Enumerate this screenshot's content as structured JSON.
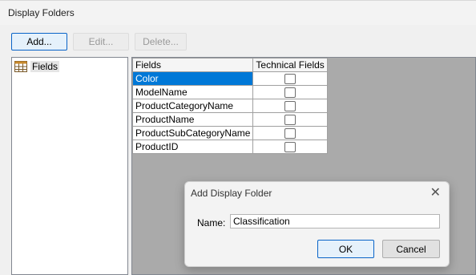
{
  "window": {
    "title": "Display Folders"
  },
  "toolbar": {
    "add_label": "Add...",
    "edit_label": "Edit...",
    "delete_label": "Delete..."
  },
  "tree": {
    "root_label": "Fields",
    "root_icon": "table-icon"
  },
  "grid": {
    "headers": [
      "Fields",
      "Technical Fields"
    ],
    "rows": [
      {
        "field": "Color",
        "technical": false,
        "selected": true
      },
      {
        "field": "ModelName",
        "technical": false,
        "selected": false
      },
      {
        "field": "ProductCategoryName",
        "technical": false,
        "selected": false
      },
      {
        "field": "ProductName",
        "technical": false,
        "selected": false
      },
      {
        "field": "ProductSubCategoryName",
        "technical": false,
        "selected": false
      },
      {
        "field": "ProductID",
        "technical": false,
        "selected": false
      }
    ]
  },
  "dialog": {
    "title": "Add Display Folder",
    "name_label": "Name:",
    "name_value": "Classification",
    "ok_label": "OK",
    "cancel_label": "Cancel",
    "close_icon": "close-icon"
  },
  "colors": {
    "selection": "#0078d7",
    "grid_background": "#aaaaaa",
    "accent_border": "#0a64c8"
  }
}
